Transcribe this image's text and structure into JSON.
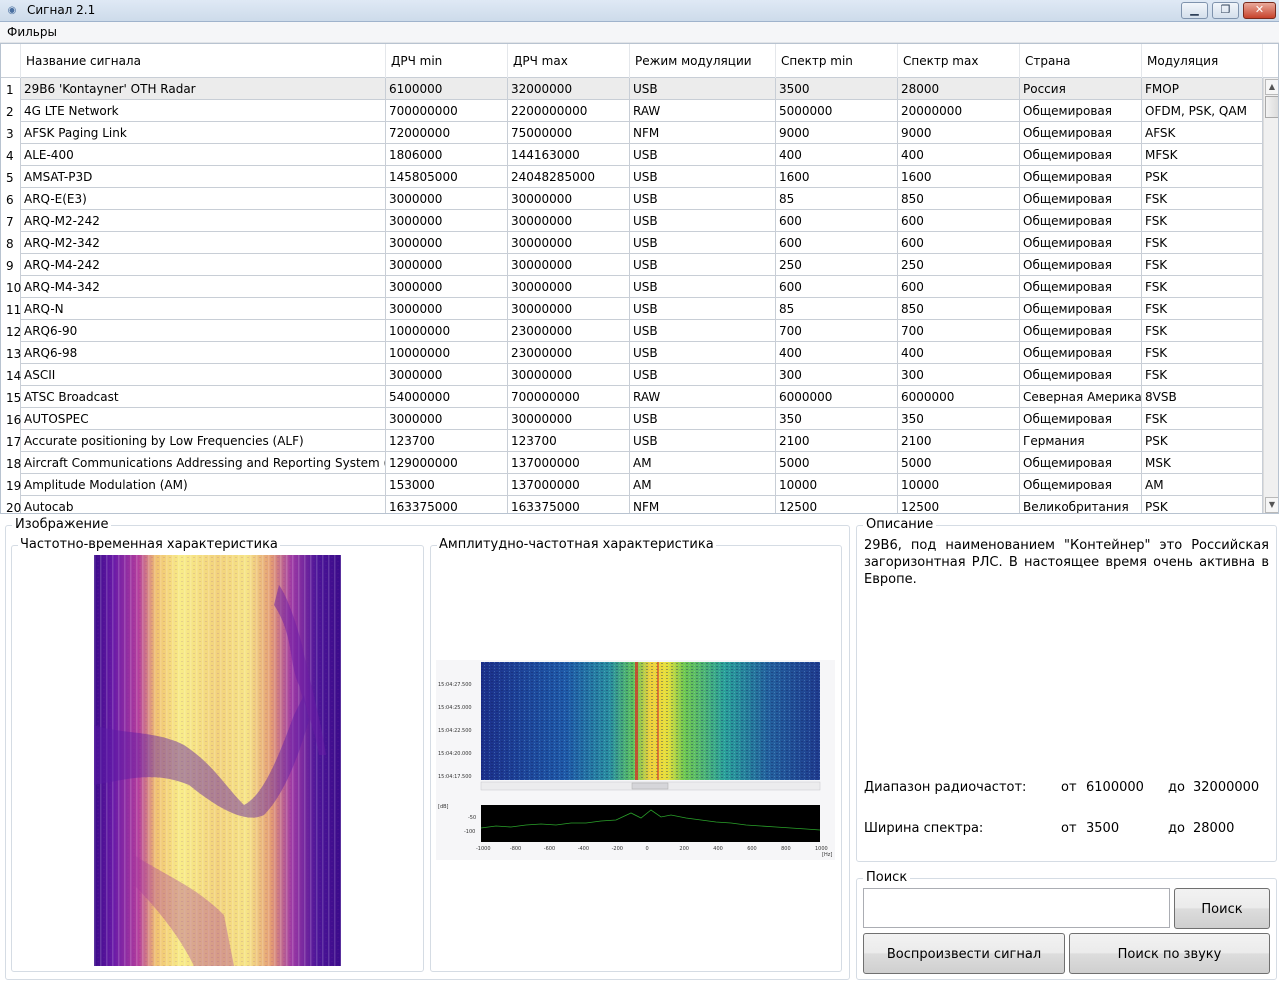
{
  "window": {
    "title": "Сигнал 2.1",
    "min_glyph": "▁",
    "max_glyph": "❐",
    "close_glyph": "✕"
  },
  "menu": [
    "Фильры"
  ],
  "table": {
    "columns": [
      "Название сигнала",
      "ДРЧ min",
      "ДРЧ max",
      "Режим модуляции",
      "Спектр min",
      "Спектр max",
      "Страна",
      "Модуляция"
    ],
    "rows": [
      [
        "1",
        "29B6 'Kontayner' OTH Radar",
        "6100000",
        "32000000",
        "USB",
        "3500",
        "28000",
        "Россия",
        "FMOP"
      ],
      [
        "2",
        "4G LTE Network",
        "700000000",
        "2200000000",
        "RAW",
        "5000000",
        "20000000",
        "Общемировая",
        "OFDM, PSK, QAM"
      ],
      [
        "3",
        "AFSK Paging Link",
        "72000000",
        "75000000",
        "NFM",
        "9000",
        "9000",
        "Общемировая",
        "AFSK"
      ],
      [
        "4",
        "ALE-400",
        "1806000",
        "144163000",
        "USB",
        "400",
        "400",
        "Общемировая",
        "MFSK"
      ],
      [
        "5",
        "AMSAT-P3D",
        "145805000",
        "24048285000",
        "USB",
        "1600",
        "1600",
        "Общемировая",
        "PSK"
      ],
      [
        "6",
        "ARQ-E(E3)",
        "3000000",
        "30000000",
        "USB",
        "85",
        "850",
        "Общемировая",
        "FSK"
      ],
      [
        "7",
        "ARQ-M2-242",
        "3000000",
        "30000000",
        "USB",
        "600",
        "600",
        "Общемировая",
        "FSK"
      ],
      [
        "8",
        "ARQ-M2-342",
        "3000000",
        "30000000",
        "USB",
        "600",
        "600",
        "Общемировая",
        "FSK"
      ],
      [
        "9",
        "ARQ-M4-242",
        "3000000",
        "30000000",
        "USB",
        "250",
        "250",
        "Общемировая",
        "FSK"
      ],
      [
        "10",
        "ARQ-M4-342",
        "3000000",
        "30000000",
        "USB",
        "600",
        "600",
        "Общемировая",
        "FSK"
      ],
      [
        "11",
        "ARQ-N",
        "3000000",
        "30000000",
        "USB",
        "85",
        "850",
        "Общемировая",
        "FSK"
      ],
      [
        "12",
        "ARQ6-90",
        "10000000",
        "23000000",
        "USB",
        "700",
        "700",
        "Общемировая",
        "FSK"
      ],
      [
        "13",
        "ARQ6-98",
        "10000000",
        "23000000",
        "USB",
        "400",
        "400",
        "Общемировая",
        "FSK"
      ],
      [
        "14",
        "ASCII",
        "3000000",
        "30000000",
        "USB",
        "300",
        "300",
        "Общемировая",
        "FSK"
      ],
      [
        "15",
        "ATSC Broadcast",
        "54000000",
        "700000000",
        "RAW",
        "6000000",
        "6000000",
        "Северная Америка",
        "8VSB"
      ],
      [
        "16",
        "AUTOSPEC",
        "3000000",
        "30000000",
        "USB",
        "350",
        "350",
        "Общемировая",
        "FSK"
      ],
      [
        "17",
        "Accurate positioning by Low Frequencies (ALF)",
        "123700",
        "123700",
        "USB",
        "2100",
        "2100",
        "Германия",
        "PSK"
      ],
      [
        "18",
        "Aircraft Communications Addressing and Reporting System (ACARS)",
        "129000000",
        "137000000",
        "AM",
        "5000",
        "5000",
        "Общемировая",
        "MSK"
      ],
      [
        "19",
        "Amplitude Modulation (AM)",
        "153000",
        "137000000",
        "AM",
        "10000",
        "10000",
        "Общемировая",
        "AM"
      ],
      [
        "20",
        "Autocab",
        "163375000",
        "163375000",
        "NFM",
        "12500",
        "12500",
        "Великобритания",
        "PSK"
      ]
    ],
    "selected_row": 1,
    "scroll_up_glyph": "▲",
    "scroll_down_glyph": "▼"
  },
  "image_group": {
    "label": "Изображение",
    "time_freq_title": "Частотно-временная характеристика",
    "amp_freq_title": "Амплитудно-частотная характеристика",
    "waterfall_time_labels": [
      "15:04:27.500",
      "15:04:25.000",
      "15:04:22.500",
      "15:04:20.000",
      "15:04:17.500"
    ],
    "spectrum_x_labels": [
      "-1000",
      "-800",
      "-600",
      "-400",
      "-200",
      "0",
      "200",
      "400",
      "600",
      "800",
      "1000"
    ],
    "spectrum_y_labels": [
      "[dB]",
      "-50",
      "-100"
    ],
    "spectrum_x_unit": "[Hz]"
  },
  "description": {
    "label": "Описание",
    "text": "29B6, под наименованием \"Контейнер\" это Российская загоризонтная РЛС. В настоящее время очень активна в Европе.",
    "freq_range_label": "Диапазон радиочастот:",
    "freq_from_label": "от",
    "freq_from": "6100000",
    "freq_to_label": "до",
    "freq_to": "32000000",
    "bandwidth_label": "Ширина спектра:",
    "bw_from_label": "от",
    "bw_from": "3500",
    "bw_to_label": "до",
    "bw_to": "28000"
  },
  "search": {
    "label": "Поиск",
    "input_value": "",
    "search_button": "Поиск",
    "play_button": "Воспроизвести сигнал",
    "sound_search_button": "Поиск по звуку"
  },
  "colors": {
    "plasma_dark": "#3b0a8c",
    "plasma_mid": "#c43ea0",
    "plasma_light": "#f7e06a",
    "waterfall_bg": "#1f3f8a",
    "spectrum_line": "#2aa22a"
  }
}
